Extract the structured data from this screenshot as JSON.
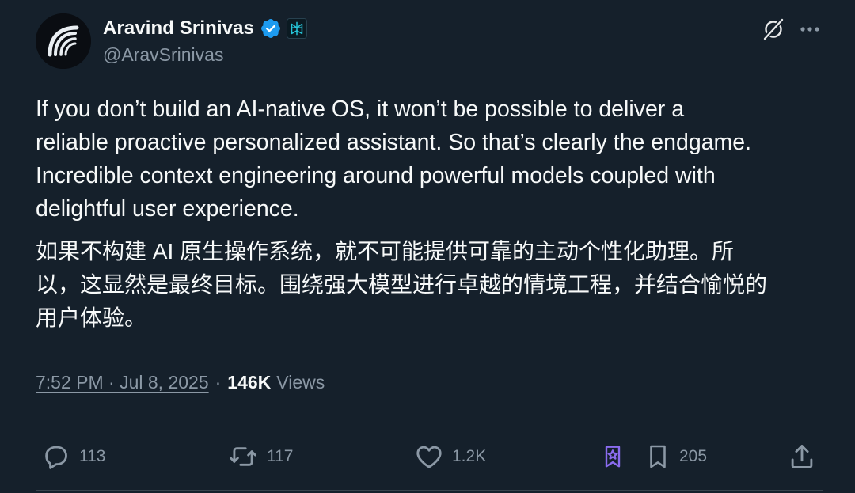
{
  "author": {
    "display_name": "Aravind Srinivas",
    "handle": "@AravSrinivas",
    "verified_badge_color": "#1d9bf0",
    "affiliate_icon": "perplexity-logo-icon"
  },
  "tweet": {
    "text_en": "If you don’t build an AI-native OS, it won’t be possible to deliver a\nreliable proactive personalized assistant. So that’s clearly the endgame.\nIncredible context engineering around powerful models coupled with\ndelightful user experience.",
    "text_zh": "如果不构建 AI 原生操作系统，就不可能提供可靠的主动个性化助理。所\n以，这显然是最终目标。围绕强大模型进行卓越的情境工程，并结合愉悦的\n用户体验。",
    "time": "7:52 PM · Jul 8, 2025",
    "separator": "·",
    "views_count": "146K",
    "views_label": "Views"
  },
  "actions": {
    "replies": "113",
    "reposts": "117",
    "likes": "1.2K",
    "bookmarks": "205"
  },
  "colors": {
    "background": "#15202b",
    "text_primary": "#f7f9f9",
    "text_secondary": "#8b98a5",
    "divider": "#38444d",
    "grok_accent": "#8b6cf0"
  }
}
